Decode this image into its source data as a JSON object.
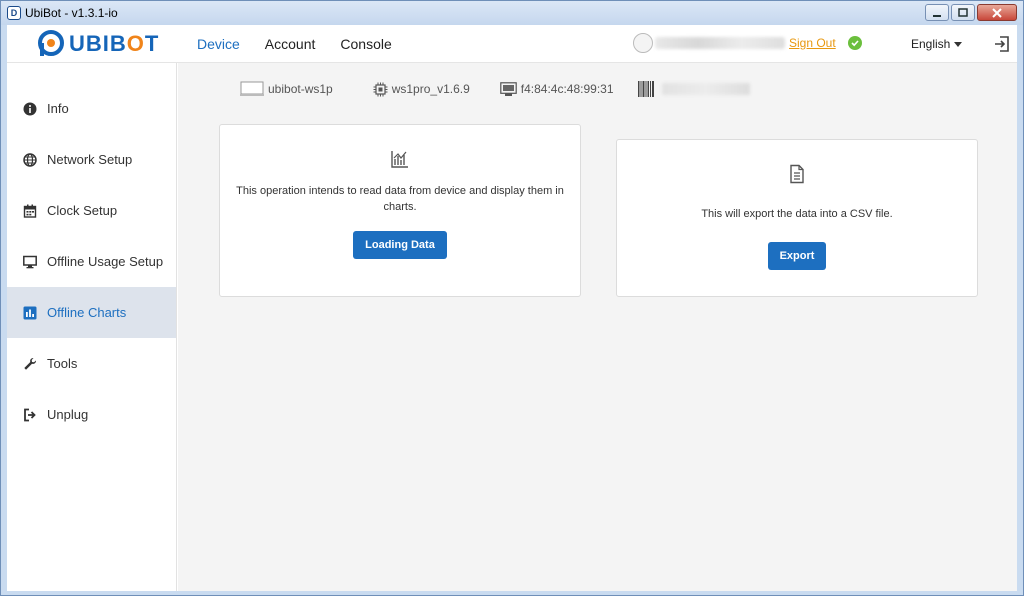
{
  "window": {
    "title": "UbiBot - v1.3.1-io",
    "app_icon_letter": "D"
  },
  "header": {
    "logo_text_pre": "UBIB",
    "logo_text_accent": "O",
    "logo_text_post": "T",
    "nav": [
      {
        "label": "Device",
        "active": true
      },
      {
        "label": "Account",
        "active": false
      },
      {
        "label": "Console",
        "active": false
      }
    ],
    "sign_out_label": "Sign Out",
    "language": "English"
  },
  "sidebar": {
    "items": [
      {
        "label": "Info",
        "icon": "info-icon"
      },
      {
        "label": "Network Setup",
        "icon": "globe-icon"
      },
      {
        "label": "Clock Setup",
        "icon": "calendar-icon"
      },
      {
        "label": "Offline Usage Setup",
        "icon": "monitor-icon"
      },
      {
        "label": "Offline Charts",
        "icon": "bar-chart-icon",
        "active": true
      },
      {
        "label": "Tools",
        "icon": "wrench-icon"
      },
      {
        "label": "Unplug",
        "icon": "unplug-icon"
      }
    ]
  },
  "device_info": {
    "name": "ubibot-ws1p",
    "firmware": "ws1pro_v1.6.9",
    "mac": "f4:84:4c:48:99:31"
  },
  "cards": {
    "load": {
      "description": "This operation intends to read data from device and display them in charts.",
      "button_label": "Loading Data"
    },
    "export": {
      "description": "This will export the data into a CSV file.",
      "button_label": "Export"
    }
  },
  "colors": {
    "accent": "#1d6fc0",
    "sign_out": "#e8980f",
    "status_ok": "#6bbf3d",
    "logo_orange": "#f0841a"
  }
}
